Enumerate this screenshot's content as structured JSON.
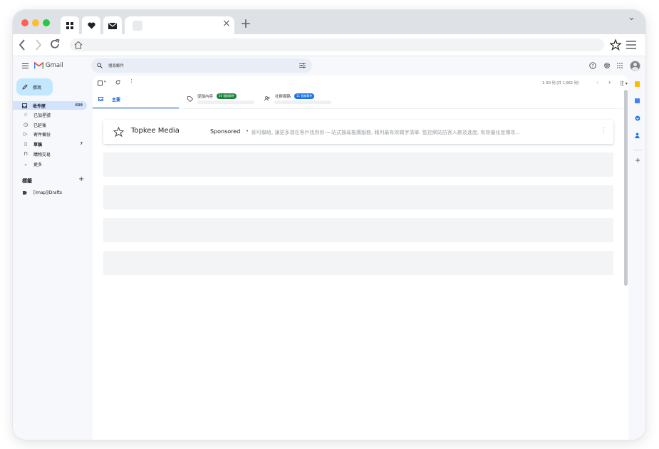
{
  "browser": {
    "pinned_tabs": [
      {
        "icon": "grid-icon"
      },
      {
        "icon": "heart-icon"
      },
      {
        "icon": "mail-icon"
      }
    ],
    "new_tab_label": "+",
    "tab_close": "×",
    "collapse": "⌄"
  },
  "gmail": {
    "app_name": "Gmail",
    "search_placeholder": "搜尋郵件",
    "compose_label": "撰寫",
    "nav": [
      {
        "label": "收件匣",
        "count": "609",
        "icon": "inbox-icon",
        "active": true
      },
      {
        "label": "已加星號",
        "count": "",
        "icon": "star-icon"
      },
      {
        "label": "已延後",
        "count": "",
        "icon": "clock-icon"
      },
      {
        "label": "寄件備份",
        "count": "",
        "icon": "send-icon"
      },
      {
        "label": "草稿",
        "count": "7",
        "icon": "draft-icon"
      },
      {
        "label": "購物交易",
        "count": "",
        "icon": "shopping-icon"
      },
      {
        "label": "更多",
        "count": "",
        "icon": "chevron-down-icon"
      }
    ],
    "labels_heading": "標籤",
    "labels": [
      {
        "label": "[Imap]/Drafts"
      }
    ],
    "pagination": "1–50 列 (共 1,062 列)",
    "language": "注",
    "tabs": [
      {
        "label": "主要",
        "badge": "",
        "active": true
      },
      {
        "label": "促銷內容",
        "badge": "50 個新郵件"
      },
      {
        "label": "社群網路",
        "badge": "11 個新郵件"
      }
    ],
    "email": {
      "sender": "Topkee Media",
      "sponsored": "Sponsored",
      "separator": "•",
      "snippet": "即可聯絡, 讓更多潛在客戶找到你-一站式搜尋推廣服務, 藉列最有效關字清單. 監控網站訪客人數及進度, 有效優化宣傳攻..."
    }
  },
  "colors": {
    "accent": "#0b57d0",
    "compose_bg": "#c2e7ff",
    "active_nav": "#d3e3fd",
    "promo_badge": "#188038",
    "social_badge": "#1a73e8"
  }
}
